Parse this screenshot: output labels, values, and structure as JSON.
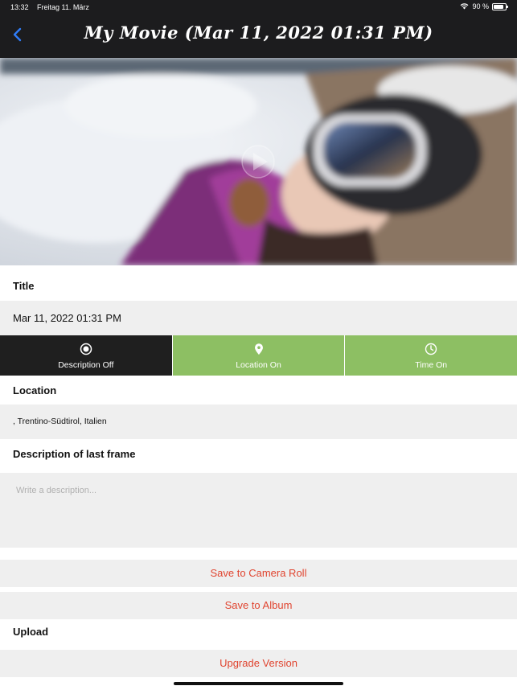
{
  "status_bar": {
    "time": "13:32",
    "date": "Freitag 11. März",
    "battery": "90 %",
    "battery_level": 0.9
  },
  "nav": {
    "title": "My Movie (Mar 11, 2022 01:31 PM)"
  },
  "sections": {
    "title_label": "Title",
    "title_value": "Mar 11, 2022 01:31 PM",
    "location_label": "Location",
    "location_value": ", Trentino-Südtirol, Italien",
    "description_label": "Description of last frame",
    "description_placeholder": "Write a description...",
    "upload_label": "Upload"
  },
  "toggles": [
    {
      "label": "Description Off",
      "icon": "record-icon",
      "state": "off"
    },
    {
      "label": "Location On",
      "icon": "location-pin-icon",
      "state": "on"
    },
    {
      "label": "Time On",
      "icon": "clock-icon",
      "state": "on"
    }
  ],
  "actions": {
    "save_camera_roll": "Save to Camera Roll",
    "save_album": "Save to Album",
    "upgrade": "Upgrade Version"
  },
  "colors": {
    "nav_bg": "#1c1c1e",
    "toggle_on": "#8dbf63",
    "toggle_off": "#1f1f1f",
    "action_text": "#e0442f",
    "back_arrow": "#2f7cf6"
  }
}
